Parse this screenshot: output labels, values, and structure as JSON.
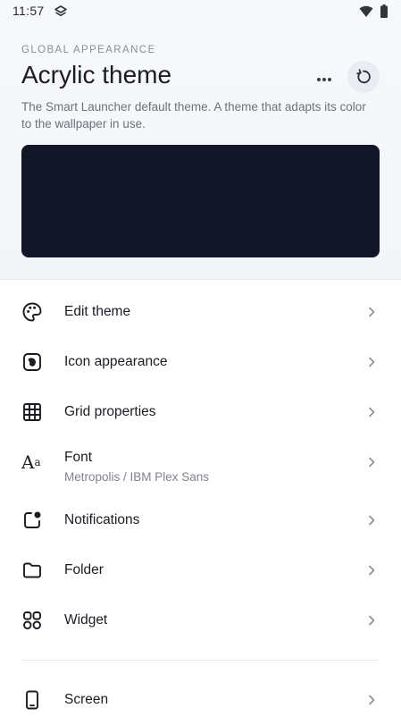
{
  "status_bar": {
    "time": "11:57"
  },
  "header": {
    "overline": "GLOBAL APPEARANCE",
    "title": "Acrylic theme",
    "description": "The Smart Launcher default theme. A theme that adapts its color to the wallpaper in use.",
    "more_icon": "more-horizontal-icon",
    "reset_icon": "reset-icon",
    "preview_color": "#121626"
  },
  "menu": [
    {
      "label": "Edit theme",
      "icon": "palette-icon"
    },
    {
      "label": "Icon appearance",
      "icon": "icon-shape-icon"
    },
    {
      "label": "Grid properties",
      "icon": "grid-icon"
    },
    {
      "label": "Font",
      "subtitle": "Metropolis / IBM Plex Sans",
      "icon": "font-icon"
    },
    {
      "label": "Notifications",
      "icon": "notification-badge-icon"
    },
    {
      "label": "Folder",
      "icon": "folder-icon"
    },
    {
      "label": "Widget",
      "icon": "widget-icon"
    },
    {
      "label": "Screen",
      "icon": "phone-screen-icon"
    }
  ],
  "colors": {
    "background": "#ffffff",
    "header_background": "#f5f7fa",
    "text_primary": "#1b1c22",
    "text_secondary": "#6e717a"
  }
}
